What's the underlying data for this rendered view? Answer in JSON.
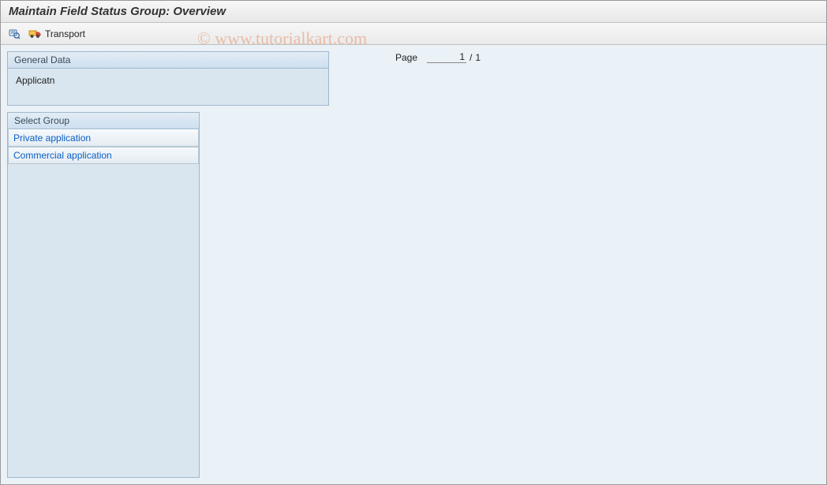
{
  "title": "Maintain Field Status Group: Overview",
  "toolbar": {
    "transport_label": "Transport"
  },
  "general_data": {
    "header": "General Data",
    "field_label": "Applicatn"
  },
  "select_group": {
    "header": "Select Group",
    "items": [
      {
        "label": "Private application"
      },
      {
        "label": "Commercial application"
      }
    ]
  },
  "pager": {
    "label": "Page",
    "current": "1",
    "separator": "/",
    "total": "1"
  },
  "watermark": "© www.tutorialkart.com"
}
